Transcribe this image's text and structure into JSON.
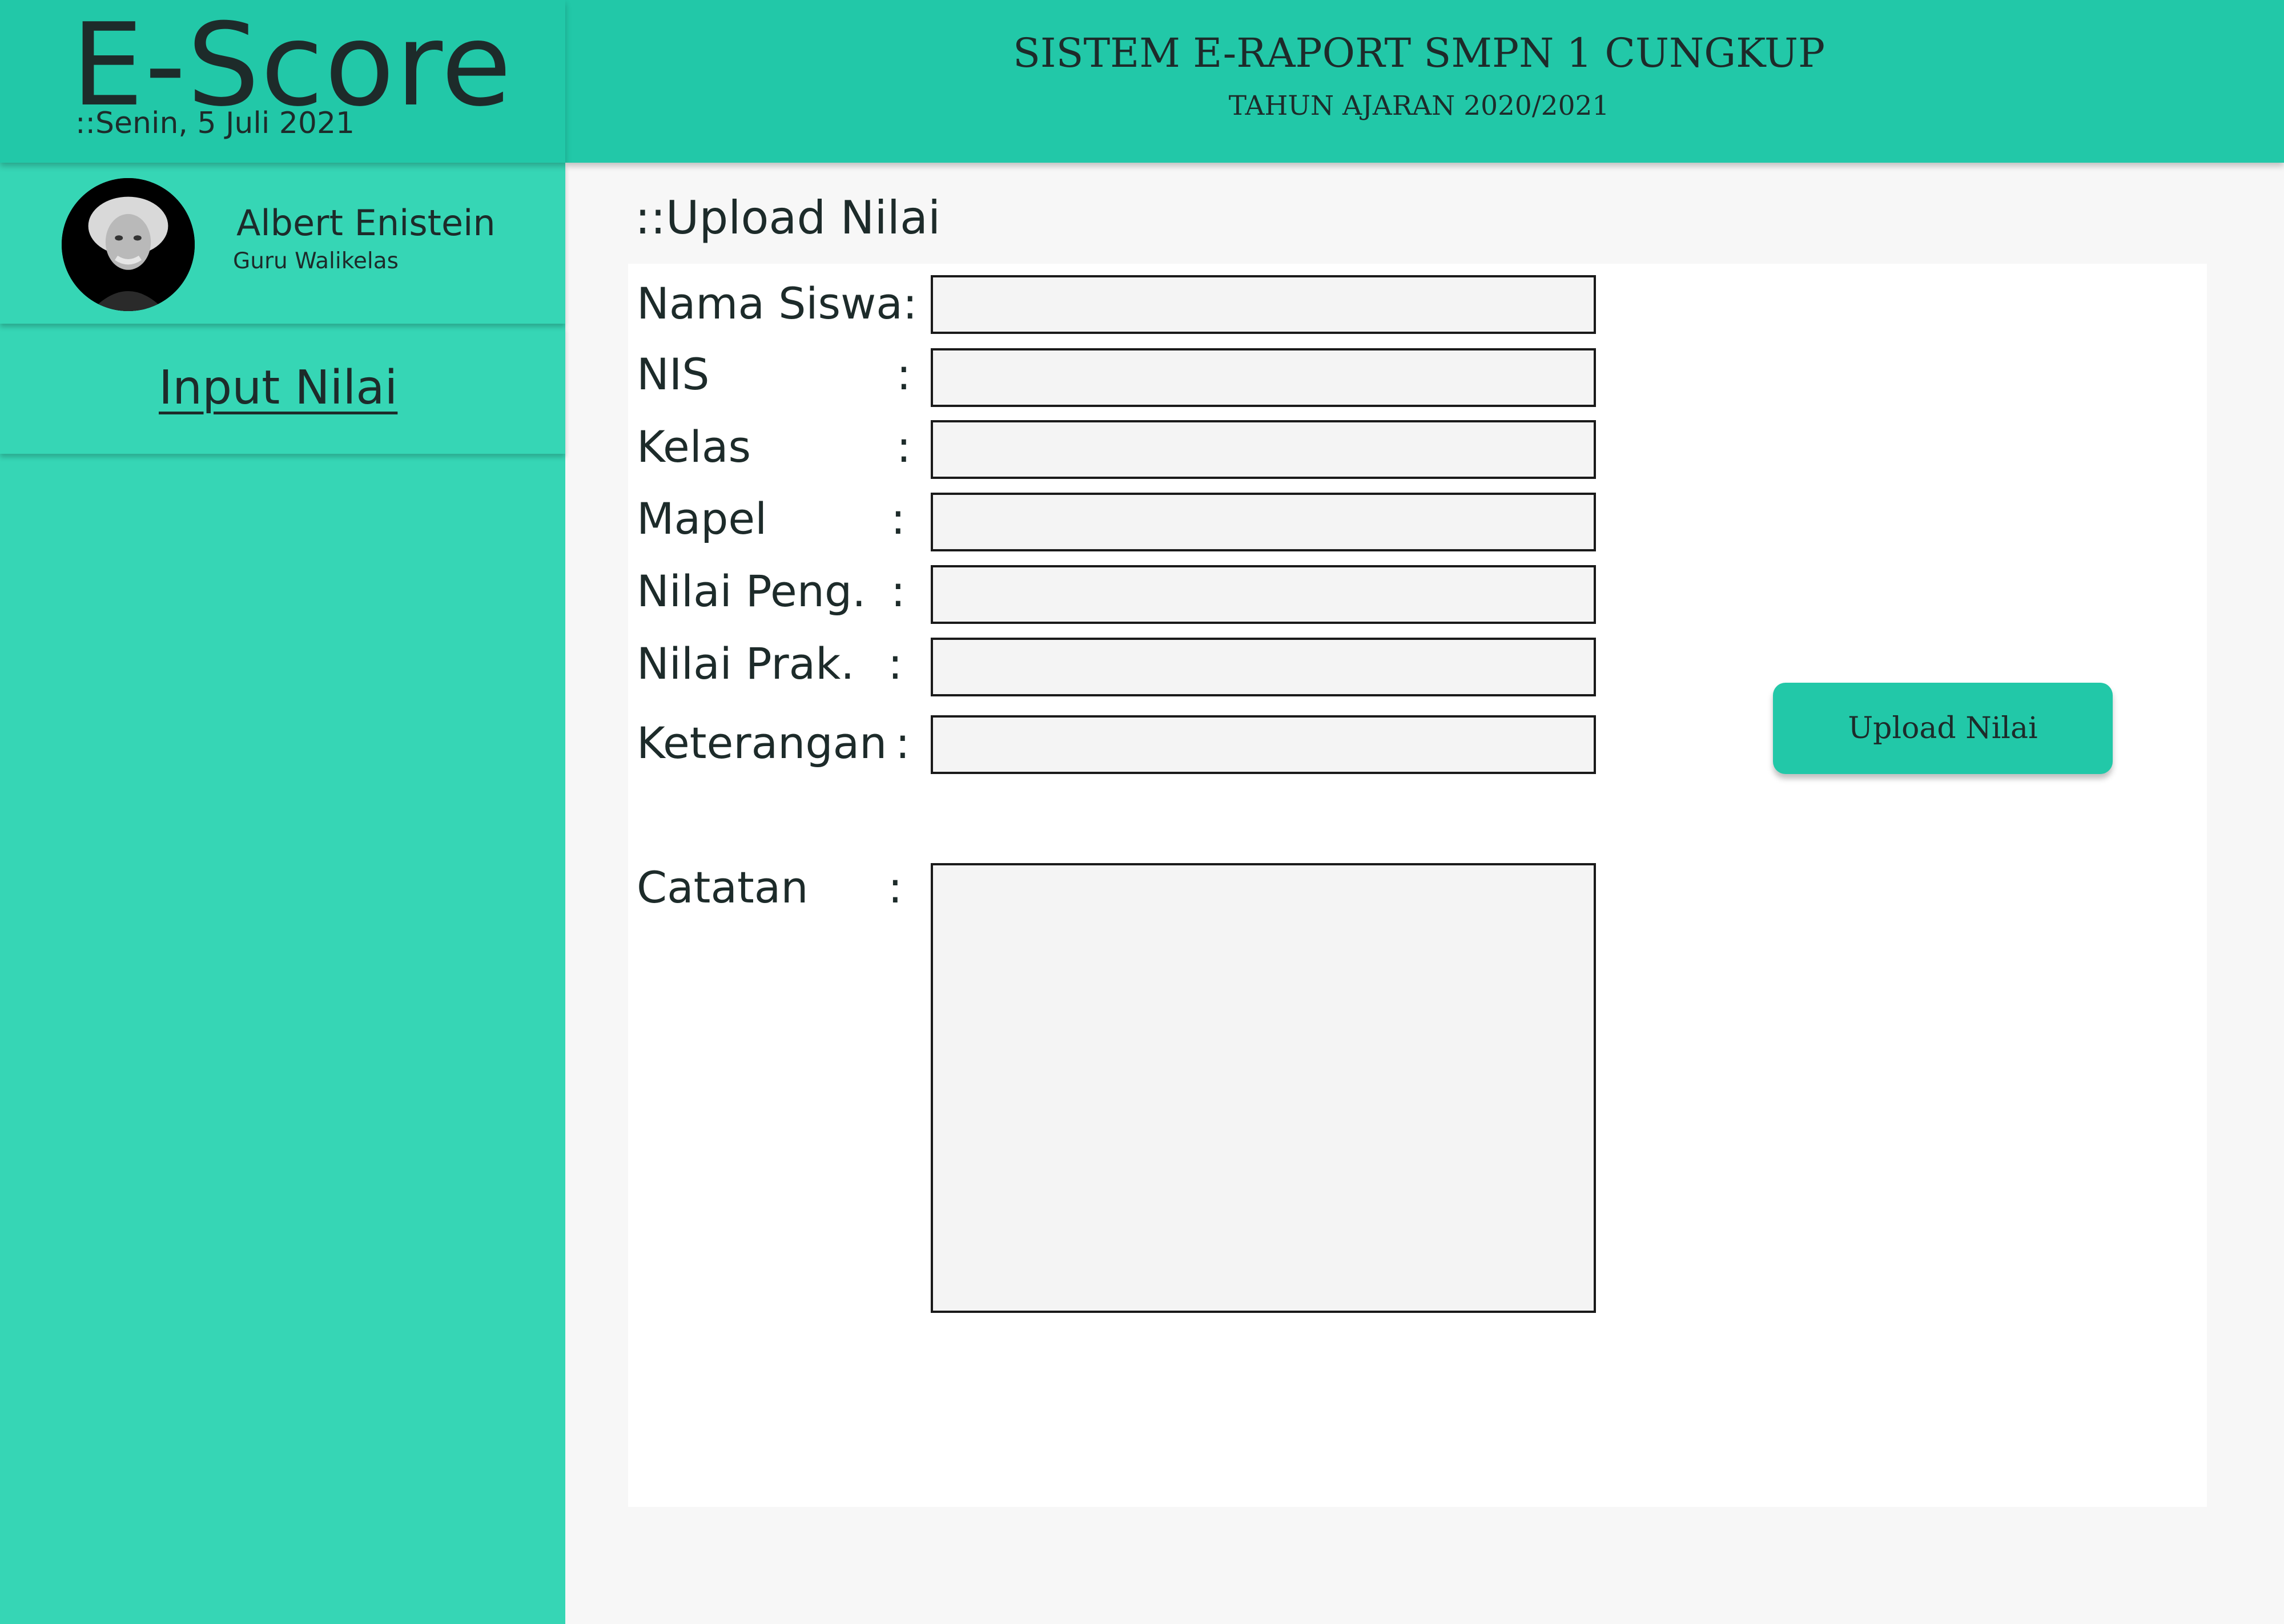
{
  "brand": {
    "title": "E-Score",
    "date": "::Senin, 5 Juli 2021"
  },
  "header": {
    "title": "SISTEM E-RAPORT SMPN 1 CUNGKUP",
    "subtitle": "TAHUN AJARAN 2020/2021"
  },
  "user": {
    "name": "Albert Enistein",
    "role": "Guru Walikelas",
    "avatar_icon": "user-portrait"
  },
  "sidebar": {
    "nav_label": "Input Nilai"
  },
  "main": {
    "page_title": "::Upload Nilai",
    "fields": [
      {
        "label": "Nama Siswa:",
        "colon": "",
        "value": "",
        "placeholder": ""
      },
      {
        "label": "NIS",
        "colon": ":",
        "value": "",
        "placeholder": ""
      },
      {
        "label": "Kelas",
        "colon": ":",
        "value": "",
        "placeholder": ""
      },
      {
        "label": "Mapel",
        "colon": ":",
        "value": "",
        "placeholder": ""
      },
      {
        "label": "Nilai Peng.",
        "colon": ":",
        "value": "",
        "placeholder": ""
      },
      {
        "label": "Nilai Prak.",
        "colon": ":",
        "value": "",
        "placeholder": ""
      },
      {
        "label": "Keterangan",
        "colon": ":",
        "value": "",
        "placeholder": ""
      }
    ],
    "notes": {
      "label": "Catatan",
      "colon": ":",
      "value": ""
    },
    "upload_button": "Upload Nilai"
  },
  "colors": {
    "header_bg": "#22c8a8",
    "sidebar_bg": "#36d6b5",
    "button_bg": "#22c8a8",
    "text": "#1d2b2a"
  }
}
